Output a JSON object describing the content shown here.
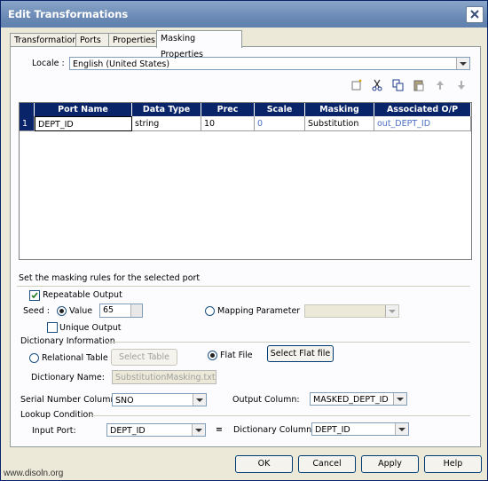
{
  "window": {
    "title": "Edit Transformations",
    "close_glyph": "✕"
  },
  "tabs": [
    "Transformation",
    "Ports",
    "Properties",
    "Masking Properties"
  ],
  "locale": {
    "label": "Locale :",
    "value": "English (United States)"
  },
  "toolbar_icons": [
    "new-icon",
    "cut-icon",
    "copy-icon",
    "paste-icon",
    "move-up-icon",
    "move-down-icon"
  ],
  "grid": {
    "columns": [
      "Port Name",
      "Data Type",
      "Prec",
      "Scale",
      "Masking",
      "Associated O/P"
    ],
    "rows": [
      {
        "num": "1",
        "port_name": "DEPT_ID",
        "data_type": "string",
        "prec": "10",
        "scale": "0",
        "masking": "Substitution",
        "assoc": "out_DEPT_ID"
      }
    ]
  },
  "rules": {
    "heading": "Set the masking rules for the selected port",
    "repeatable_output": "Repeatable Output",
    "seed_label": "Seed :",
    "value_label": "Value",
    "seed_value": "65",
    "mapping_parameter": "Mapping Parameter",
    "unique_output": "Unique Output",
    "dictionary_info": "Dictionary Information",
    "relational_table": "Relational Table",
    "select_table": "Select Table",
    "flat_file": "Flat File",
    "select_flat_file": "Select Flat file",
    "dictionary_name_label": "Dictionary Name:",
    "dictionary_name_value": "SubstitutionMasking.txt",
    "serial_number_label": "Serial Number Column:",
    "serial_number_value": "SNO",
    "output_column_label": "Output Column:",
    "output_column_value": "MASKED_DEPT_ID",
    "lookup_condition": "Lookup Condition",
    "input_port_label": "Input Port:",
    "input_port_value": "DEPT_ID",
    "equals": "=",
    "dictionary_column_label": "Dictionary Column:",
    "dictionary_column_value": "DEPT_ID"
  },
  "buttons": {
    "ok": "OK",
    "cancel": "Cancel",
    "apply": "Apply",
    "help": "Help"
  },
  "watermark": "www.disoln.org"
}
